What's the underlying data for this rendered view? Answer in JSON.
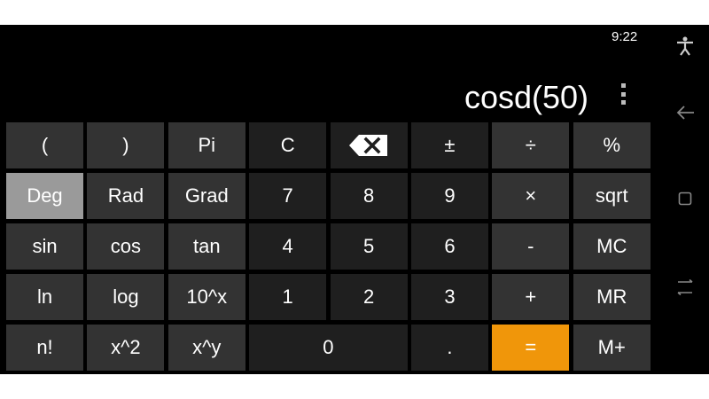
{
  "status_bar": {
    "time": "9:22"
  },
  "display": {
    "expression": "cosd(50)"
  },
  "icons": {
    "menu": "more-vertical-icon",
    "nav": [
      "accessibility-icon",
      "back-icon",
      "recents-icon",
      "switch-app-icon"
    ]
  },
  "colors": {
    "equals_key": "#f0960a",
    "selected_mode": "#9a9a9a",
    "background": "#000000"
  },
  "keypad": {
    "open_paren": "(",
    "close_paren": ")",
    "pi": "Pi",
    "clear": "C",
    "sign": "±",
    "divide": "÷",
    "percent": "%",
    "deg": "Deg",
    "rad": "Rad",
    "grad": "Grad",
    "n7": "7",
    "n8": "8",
    "n9": "9",
    "multiply": "×",
    "sqrt": "sqrt",
    "sin": "sin",
    "cos": "cos",
    "tan": "tan",
    "n4": "4",
    "n5": "5",
    "n6": "6",
    "minus": "-",
    "mc": "MC",
    "ln": "ln",
    "log": "log",
    "pow10": "10^x",
    "n1": "1",
    "n2": "2",
    "n3": "3",
    "plus": "+",
    "mr": "MR",
    "fact": "n!",
    "square": "x^2",
    "pow": "x^y",
    "n0": "0",
    "dot": ".",
    "equals": "=",
    "mplus": "M+"
  }
}
